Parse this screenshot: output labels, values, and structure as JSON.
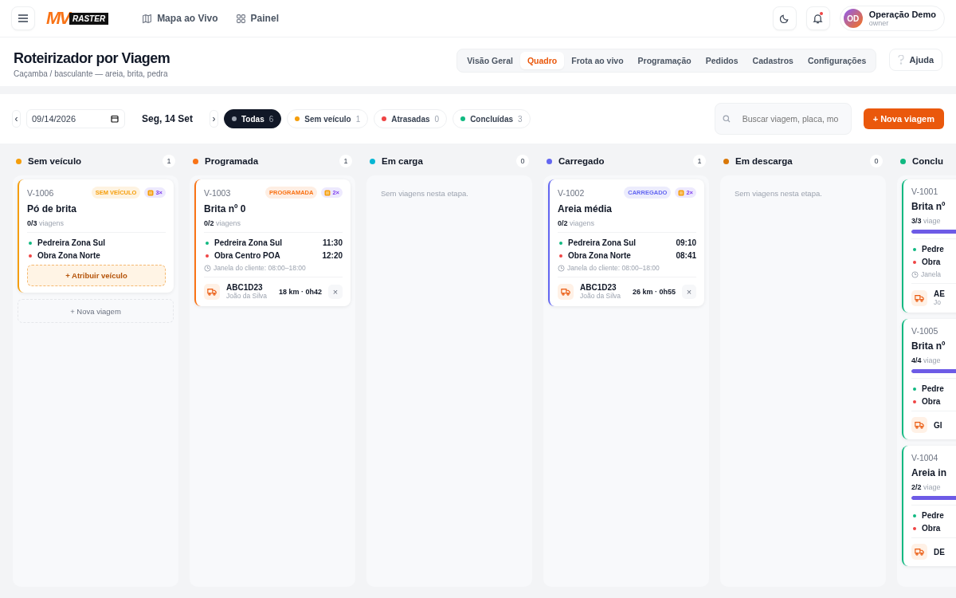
{
  "header": {
    "logo": {
      "mark": "MV",
      "text": "RASTER"
    },
    "nav": [
      {
        "label": "Mapa ao Vivo",
        "kind": "map"
      },
      {
        "label": "Painel",
        "kind": "grid"
      }
    ],
    "notifications": true,
    "user": {
      "initials": "OD",
      "name": "Operação Demo",
      "role": "owner"
    }
  },
  "page": {
    "title": "Roteirizador por Viagem",
    "subtitle": "Caçamba / basculante — areia, brita, pedra",
    "tabs": [
      {
        "label": "Visão Geral",
        "selected": false
      },
      {
        "label": "Quadro",
        "selected": true
      },
      {
        "label": "Frota ao vivo",
        "selected": false
      },
      {
        "label": "Programação",
        "selected": false
      },
      {
        "label": "Pedidos",
        "selected": false
      },
      {
        "label": "Cadastros",
        "selected": false
      },
      {
        "label": "Configurações",
        "selected": false
      }
    ],
    "help": "Ajuda"
  },
  "toolbar": {
    "prev": "‹",
    "date": "09/14/2026",
    "day": "Seg, 14 Set",
    "next": "›",
    "filters": [
      {
        "label": "Todas",
        "count": "6",
        "color": "#9ca3af",
        "selected": true
      },
      {
        "label": "Sem veículo",
        "count": "1",
        "color": "#f59e0b",
        "selected": false
      },
      {
        "label": "Atrasadas",
        "count": "0",
        "color": "#ef4444",
        "selected": false
      },
      {
        "label": "Concluídas",
        "count": "3",
        "color": "#10b981",
        "selected": false
      }
    ],
    "search": {
      "placeholder": "Buscar viagem, placa, mo"
    },
    "new_trip": "+ Nova viagem"
  },
  "columns": [
    {
      "title": "Sem veículo",
      "count": "1",
      "color": "#f59e0b",
      "cards": [
        {
          "id": "V-1006",
          "status": "SEM VEÍCULO",
          "repeat": "3×",
          "title": "Pó de brita",
          "done": "0/3",
          "unit": "viagens",
          "stops": [
            {
              "kind": "origin",
              "name": "Pedreira Zona Sul"
            },
            {
              "kind": "destination",
              "name": "Obra Zona Norte"
            }
          ],
          "assign": "+ Atribuir veículo"
        }
      ],
      "add": "+ Nova viagem"
    },
    {
      "title": "Programada",
      "count": "1",
      "color": "#f97316",
      "cards": [
        {
          "id": "V-1003",
          "status": "PROGRAMADA",
          "repeat": "2×",
          "title": "Brita nº 0",
          "done": "0/2",
          "unit": "viagens",
          "stops": [
            {
              "kind": "origin",
              "name": "Pedreira Zona Sul",
              "time": "11:30"
            },
            {
              "kind": "destination",
              "name": "Obra Centro POA",
              "time": "12:20"
            }
          ],
          "window": "Janela do cliente: 08:00–18:00",
          "vehicle": {
            "plate": "ABC1D23",
            "driver": "João da Silva",
            "route": "18 km · 0h42",
            "remove": "×"
          }
        }
      ]
    },
    {
      "title": "Em carga",
      "count": "0",
      "color": "#06b6d4",
      "empty": "Sem viagens nesta etapa."
    },
    {
      "title": "Carregado",
      "count": "1",
      "color": "#6366f1",
      "cards": [
        {
          "id": "V-1002",
          "status": "CARREGADO",
          "repeat": "2×",
          "title": "Areia média",
          "done": "0/2",
          "unit": "viagens",
          "stops": [
            {
              "kind": "origin",
              "name": "Pedreira Zona Sul",
              "time": "09:10"
            },
            {
              "kind": "destination",
              "name": "Obra Zona Norte",
              "time": "08:41"
            }
          ],
          "window": "Janela do cliente: 08:00–18:00",
          "vehicle": {
            "plate": "ABC1D23",
            "driver": "João da Silva",
            "route": "26 km · 0h55",
            "remove": "×"
          }
        }
      ]
    },
    {
      "title": "Em descarga",
      "count": "0",
      "color": "#d97706",
      "empty": "Sem viagens nesta etapa."
    },
    {
      "title": "Conclu",
      "color": "#10b981",
      "cards": [
        {
          "id": "V-1001",
          "title": "Brita nº",
          "done": "3/3",
          "unit": "viage",
          "level": 1,
          "stops": [
            {
              "kind": "origin",
              "name": "Pedre"
            },
            {
              "kind": "destination",
              "name": "Obra"
            }
          ],
          "window": "Janela",
          "vehicle": {
            "plate": "AE",
            "driver": "Jo"
          }
        },
        {
          "id": "V-1005",
          "title": "Brita nº",
          "done": "4/4",
          "unit": "viage",
          "level": 1,
          "stops": [
            {
              "kind": "origin",
              "name": "Pedre"
            },
            {
              "kind": "destination",
              "name": "Obra"
            }
          ],
          "vehicle": {
            "plate": "GI"
          }
        },
        {
          "id": "V-1004",
          "title": "Areia in",
          "done": "2/2",
          "unit": "viage",
          "level": 1,
          "stops": [
            {
              "kind": "origin",
              "name": "Pedre"
            },
            {
              "kind": "destination",
              "name": "Obra"
            }
          ],
          "vehicle": {
            "plate": "DE"
          }
        }
      ]
    }
  ]
}
